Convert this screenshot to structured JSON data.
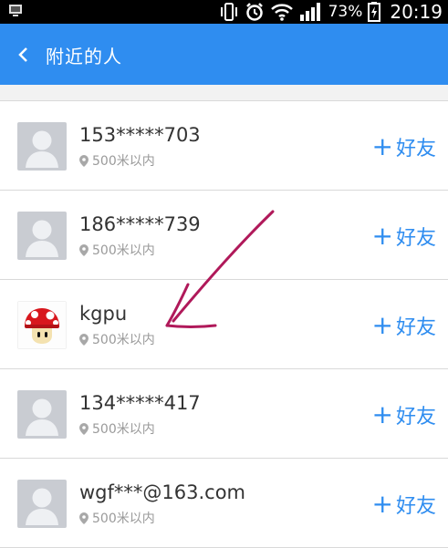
{
  "status_bar": {
    "battery": "73%",
    "time": "20:19"
  },
  "header": {
    "back_icon": "chevron-left-icon",
    "title": "附近的人"
  },
  "list": [
    {
      "name": "153*****703",
      "distance": "500米以内",
      "action": "好友",
      "avatar": "default-avatar"
    },
    {
      "name": "186*****739",
      "distance": "500米以内",
      "action": "好友",
      "avatar": "default-avatar"
    },
    {
      "name": "kgpu",
      "distance": "500米以内",
      "action": "好友",
      "avatar": "mushroom-avatar"
    },
    {
      "name": "134*****417",
      "distance": "500米以内",
      "action": "好友",
      "avatar": "default-avatar"
    },
    {
      "name": "wgf***@163.com",
      "distance": "500米以内",
      "action": "好友",
      "avatar": "default-avatar"
    }
  ],
  "colors": {
    "accent": "#2f8df0",
    "annotation": "#b0195a"
  }
}
